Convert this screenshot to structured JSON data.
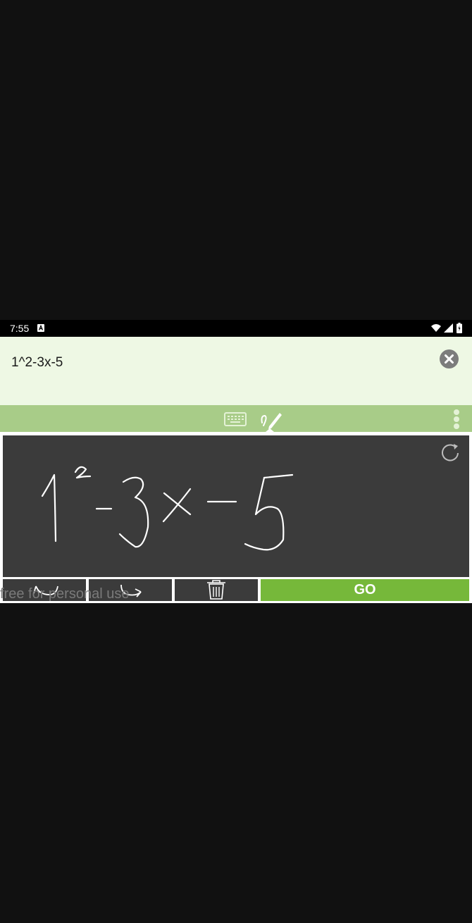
{
  "status_bar": {
    "time": "7:55",
    "notification_icon": "a-icon",
    "icons": [
      "wifi-icon",
      "signal-icon",
      "battery-icon"
    ]
  },
  "input": {
    "expression": "1^2-3x-5",
    "clear_icon": "close-circle-icon"
  },
  "toolbar": {
    "modes": [
      "keyboard-icon",
      "pen-icon"
    ],
    "active_mode": "pen",
    "menu_icon": "more-vert-icon"
  },
  "canvas": {
    "reload_icon": "reload-icon",
    "handwriting": "1^2-3x-5"
  },
  "actions": {
    "undo_icon": "undo-icon",
    "redo_icon": "redo-icon",
    "delete_icon": "trash-icon",
    "go_label": "GO"
  },
  "watermark": "free for personal use",
  "colors": {
    "input_bg": "#eef8e4",
    "toolbar_bg": "#a8cc88",
    "canvas_bg": "#3b3b3b",
    "go_bg": "#76b83a"
  }
}
